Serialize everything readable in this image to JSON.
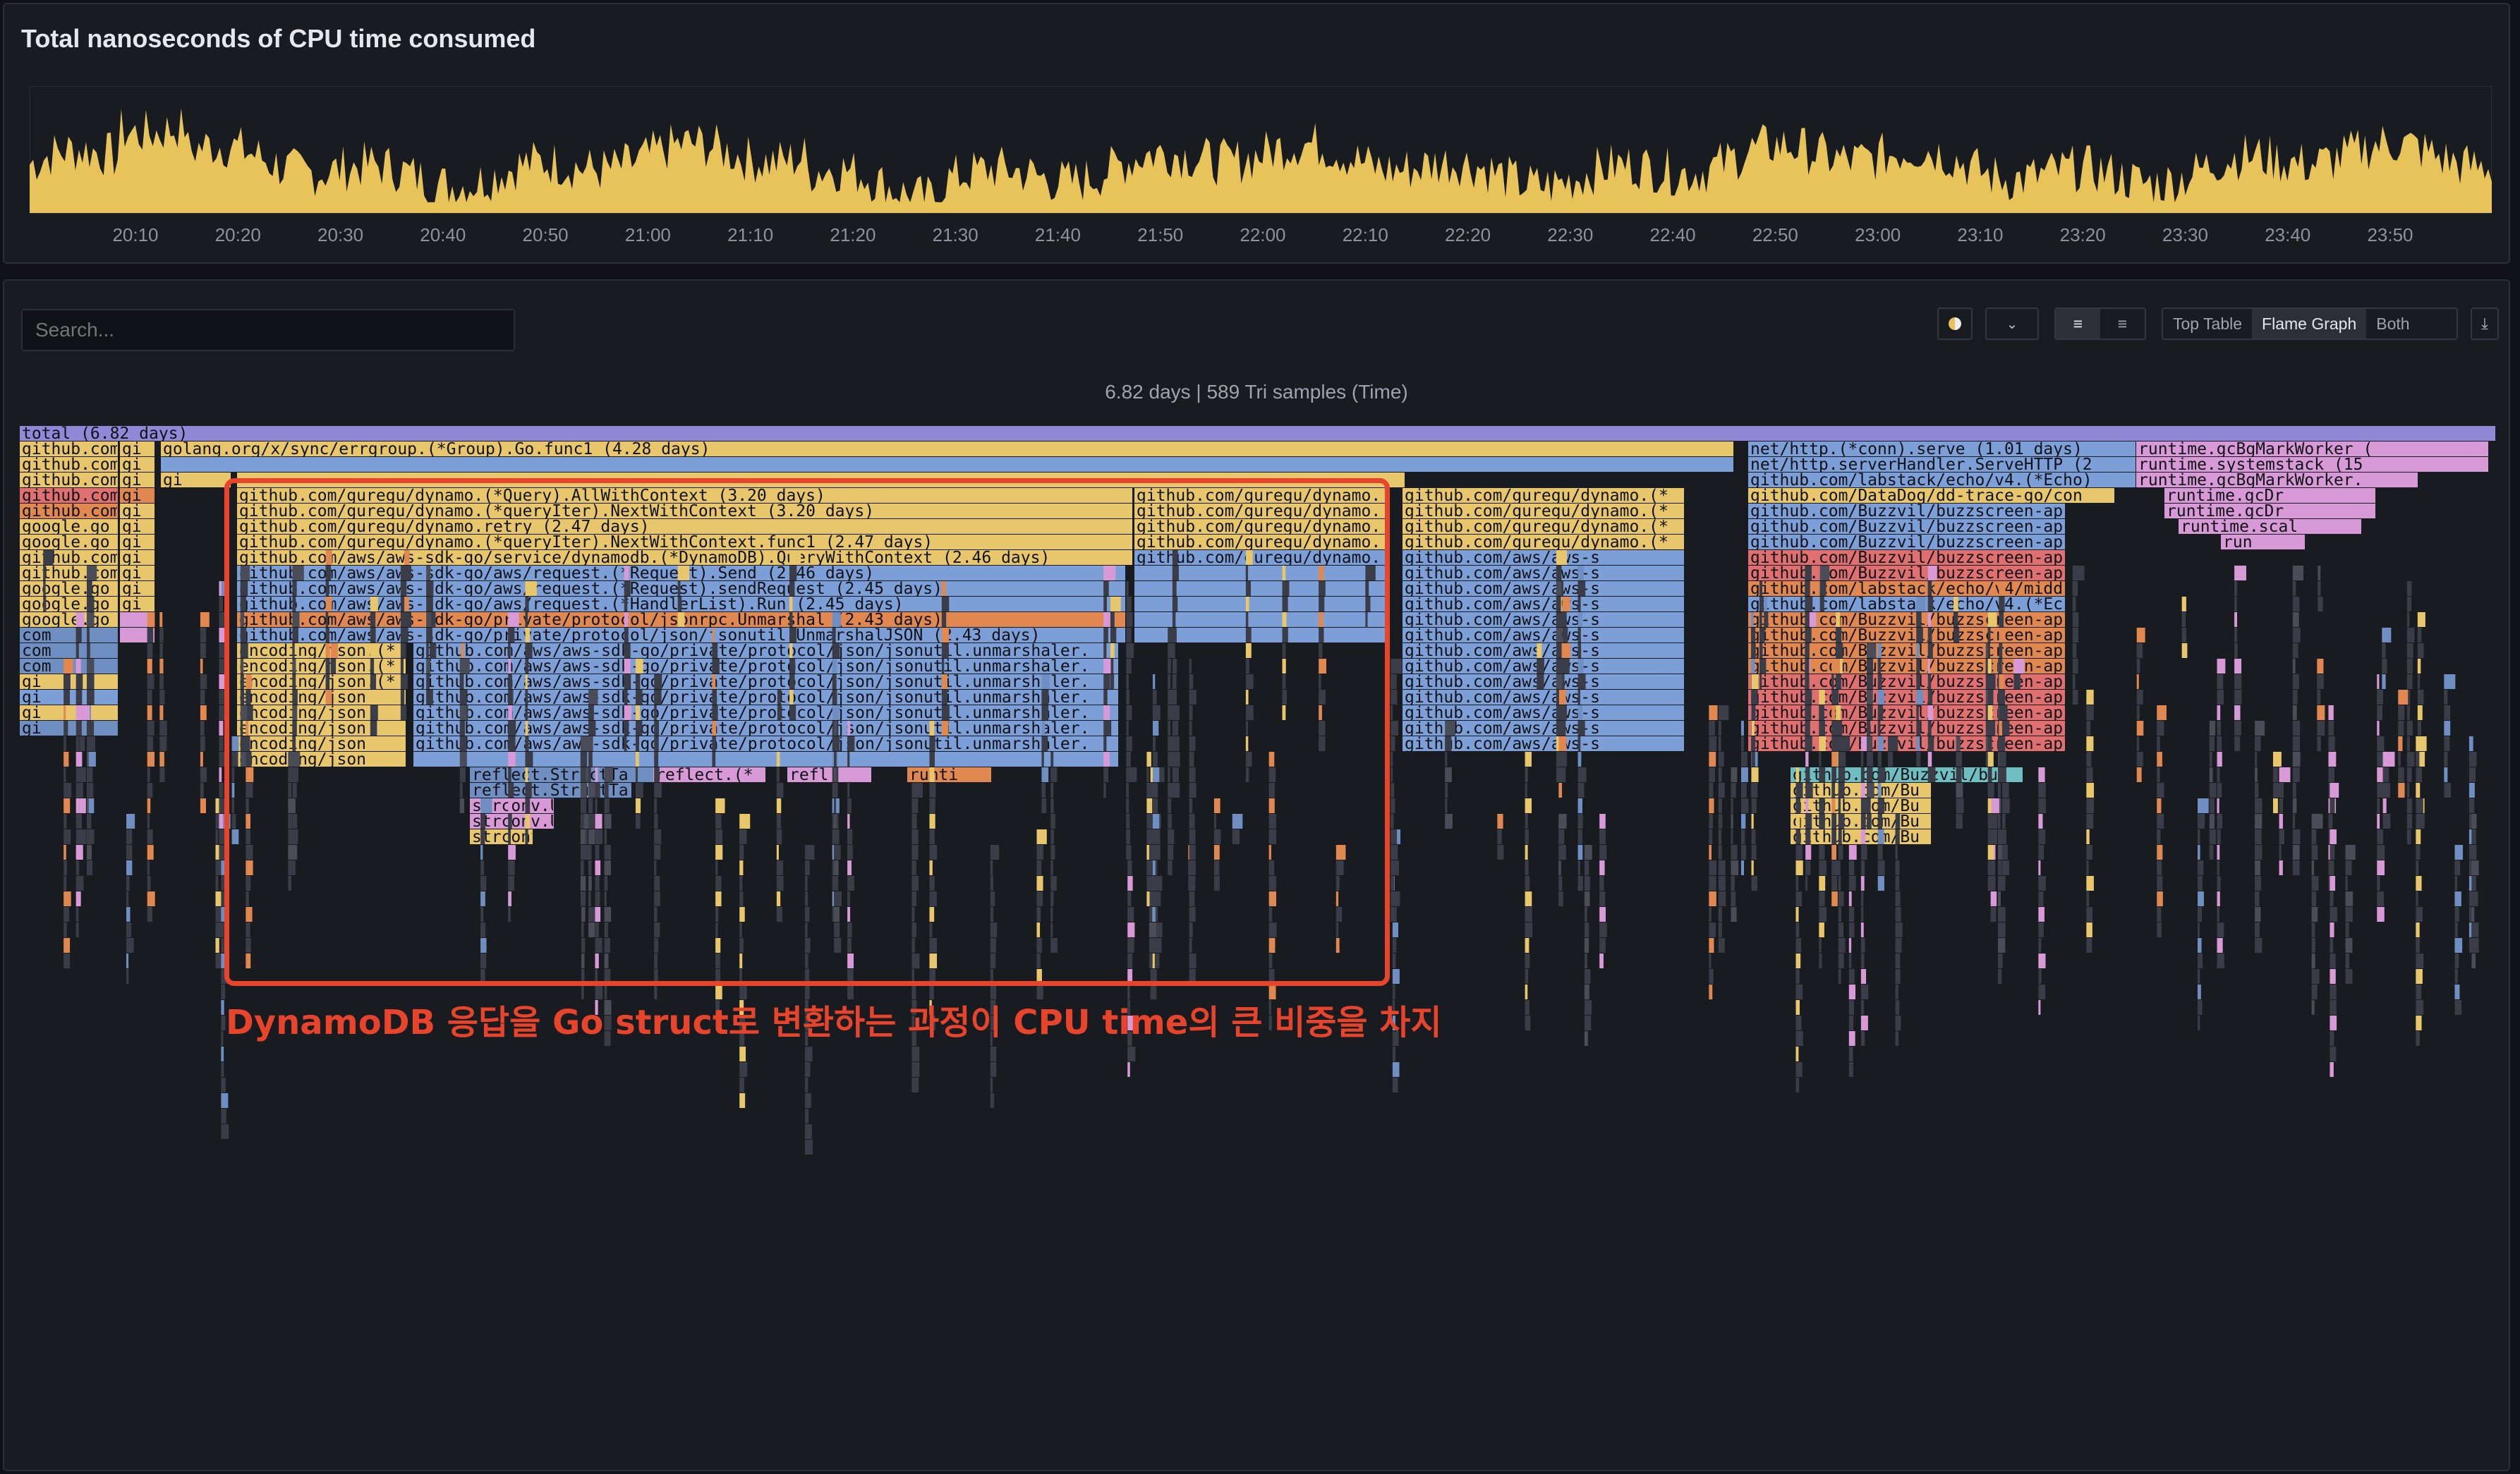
{
  "timeseries": {
    "title": "Total nanoseconds of CPU time consumed",
    "color": "#e7c35a",
    "x_ticks": [
      "20:10",
      "20:20",
      "20:30",
      "20:40",
      "20:50",
      "21:00",
      "21:10",
      "21:20",
      "21:30",
      "21:40",
      "21:50",
      "22:00",
      "22:10",
      "22:20",
      "22:30",
      "22:40",
      "22:50",
      "23:00",
      "23:10",
      "23:20",
      "23:30",
      "23:40",
      "23:50"
    ]
  },
  "toolbar": {
    "search_placeholder": "Search...",
    "view_top_table": "Top Table",
    "view_flame_graph": "Flame Graph",
    "view_both": "Both",
    "active_view": "Flame Graph",
    "color_scheme_icon": "color-circle-icon",
    "collapse_icon": "collapse-chevron-icon",
    "align_left_icon": "text-align-left-icon",
    "align_right_icon": "text-align-right-icon",
    "export_icon": "download-icon"
  },
  "flame": {
    "samples_label": "6.82 days | 589 Tri samples (Time)",
    "frames": {
      "total": "total (6.82 days)",
      "errgroup": "golang.org/x/sync/errgroup.(*Group).Go.func1 (4.28 days)",
      "netserve": "net/http.(*conn).serve (1.01 days)",
      "servehttp": "net/http.serverHandler.ServeHTTP (2",
      "echo": "github.com/labstack/echo/v4.(*Echo)",
      "ddtrace": "github.com/DataDog/dd-trace-go/con",
      "buzz1": "github.com/Buzzvil/buzzscreen-api",
      "buzz2": "github.com/Buzzvil/buzzscreen-ap",
      "echo_mid": "github.com/labstack/echo/v4/midd",
      "echo2": "github.com/labstack/echo/v4.(*Ec",
      "bgmark": "runtime.gcBgMarkWorker (",
      "bgmark2": "runtime.gcBgMarkWorker.",
      "systemstack": "runtime.systemstack (15",
      "gcdr": "runtime.gcDr",
      "scan": "runtime.scal",
      "run": "run",
      "runtime_s": "runtime.s",
      "q1": "github.com/guregu/dynamo.(*Query).AllWithContext (3.20 days)",
      "q2": "github.com/guregu/dynamo.(*queryIter).NextWithContext (3.20 days)",
      "q3": "github.com/guregu/dynamo.retry (2.47 days)",
      "q4": "github.com/guregu/dynamo.(*queryIter).NextWithContext.func1 (2.47 days)",
      "q5": "github.com/aws/aws-sdk-go/service/dynamodb.(*DynamoDB).QueryWithContext (2.46 days)",
      "q6": "github.com/aws/aws-sdk-go/aws/request.(*Request).Send (2.46 days)",
      "q7": "github.com/aws/aws-sdk-go/aws/request.(*Request).sendRequest (2.45 days)",
      "q8": "github.com/aws/aws-sdk-go/aws/request.(*HandlerList).Run (2.45 days)",
      "q9": "github.com/aws/aws-sdk-go/private/protocol/jsonrpc.Unmarshal (2.43 days)",
      "q10": "github.com/aws/aws-sdk-go/private/protocol/json/jsonutil.UnmarshalJSON (2.43 days)",
      "jsonutil": "github.com/aws/aws-sdk-go/private/protocol/json/jsonutil.unmarshaler.",
      "encjson": "encoding/json.(*",
      "encjson2": "encoding/json",
      "reflect": "reflect.StructTa",
      "strconv": "strconv.U",
      "dyn_side": "github.com/guregu/dynamo.",
      "dyn_side2": "github.com/guregu/dynamo.(*",
      "aws_side": "github.com/aws/aws-s",
      "gh_com": "github.com",
      "gi": "gi",
      "google": "google.go",
      "com": "com",
      "refl": "refl",
      "reflec": "reflect.(*",
      "run2": "runti",
      "inter": "inter",
      "encod": "encod",
      "buzz_b": "github.com/Buzzvil/bu",
      "gh_bu": "github.com/Bu"
    }
  },
  "annotation": {
    "text": "DynamoDB 응답을 Go struct로 변환하는 과정이 CPU time의 큰 비중을 차지",
    "color": "#e8442c"
  },
  "palette": {
    "total": "#9189d8",
    "yellow": "#e8c66b",
    "blue": "#7d9fd8",
    "orange": "#e08850",
    "red": "#e07070",
    "pink": "#d79ad6",
    "green": "#8ec99a",
    "teal": "#6fbfc2",
    "steel": "#6f8fc2"
  }
}
